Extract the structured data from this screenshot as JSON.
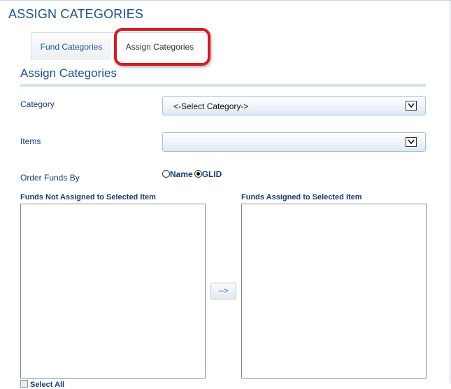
{
  "page": {
    "title": "ASSIGN CATEGORIES"
  },
  "tabs": [
    {
      "label": "Fund Categories",
      "active": false
    },
    {
      "label": "Assign Categories",
      "active": true
    }
  ],
  "section": {
    "title": "Assign Categories"
  },
  "form": {
    "category_label": "Category",
    "category_value": "<-Select Category->",
    "items_label": "Items",
    "items_value": "",
    "order_label": "Order Funds By",
    "order_options": [
      {
        "label": "Name",
        "checked": false
      },
      {
        "label": "GLID",
        "checked": true
      }
    ]
  },
  "lists": {
    "unassigned_label": "Funds Not Assigned to Selected Item",
    "assigned_label": "Funds Assigned to Selected Item",
    "move_button_label": "-->",
    "select_all_label": "Select All"
  },
  "colors": {
    "accent": "#1f4e8c",
    "highlight_ring": "#d01c24"
  },
  "icons": {
    "dropdown": "chevron-down-icon",
    "radio": "radio-icon",
    "checkbox": "checkbox-icon"
  }
}
